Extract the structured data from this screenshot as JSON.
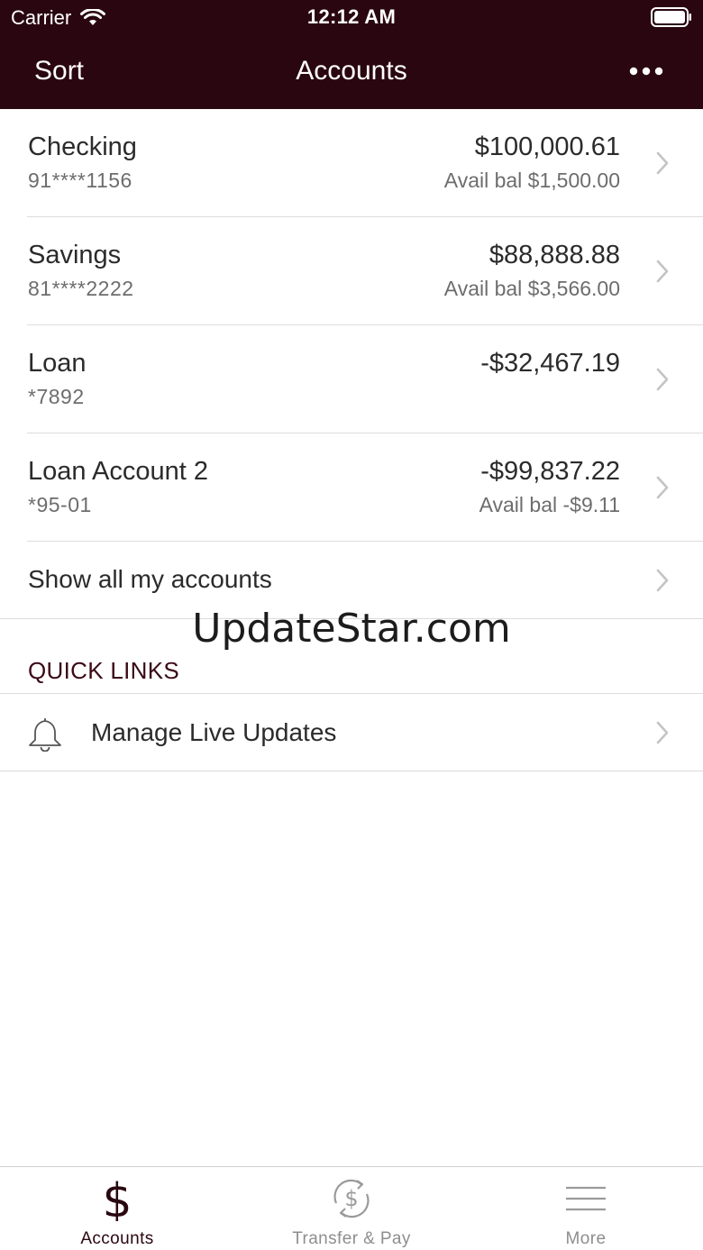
{
  "status_bar": {
    "carrier": "Carrier",
    "time": "12:12 AM"
  },
  "nav": {
    "left_label": "Sort",
    "title": "Accounts",
    "more_icon": "ellipsis-icon"
  },
  "accounts": [
    {
      "name": "Checking",
      "number": "91****1156",
      "balance": "$100,000.61",
      "avail": "Avail bal $1,500.00"
    },
    {
      "name": "Savings",
      "number": "81****2222",
      "balance": "$88,888.88",
      "avail": "Avail bal $3,566.00"
    },
    {
      "name": "Loan",
      "number": "*7892",
      "balance": "-$32,467.19",
      "avail": ""
    },
    {
      "name": "Loan Account 2",
      "number": "*95-01",
      "balance": "-$99,837.22",
      "avail": "Avail bal -$9.11"
    }
  ],
  "show_all": {
    "label": "Show all my accounts"
  },
  "watermark": "UpdateStar.com",
  "quick_links": {
    "title": "QUICK LINKS",
    "items": [
      {
        "label": "Manage Live Updates",
        "icon": "bell-icon"
      }
    ]
  },
  "tabbar": {
    "tabs": [
      {
        "label": "Accounts",
        "icon": "dollar-icon",
        "active": true
      },
      {
        "label": "Transfer & Pay",
        "icon": "transfer-dollar-icon",
        "active": false
      },
      {
        "label": "More",
        "icon": "hamburger-icon",
        "active": false
      }
    ]
  },
  "colors": {
    "header_bg": "#2a0710",
    "accent": "#3a0a16",
    "divider": "#dcdcdc",
    "secondary_text": "#6d6d6d"
  }
}
